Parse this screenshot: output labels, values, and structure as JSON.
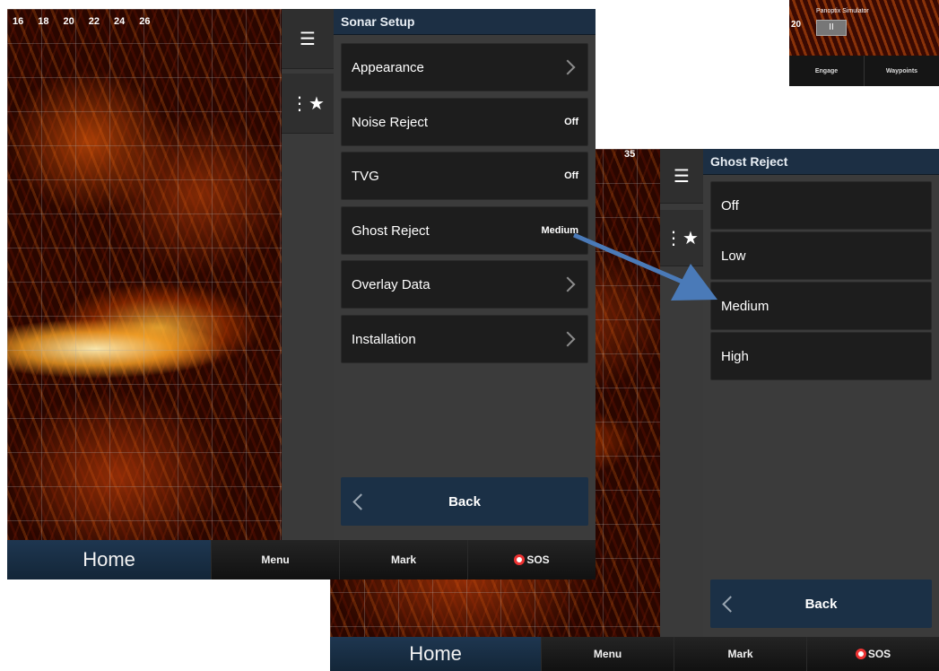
{
  "left_screen": {
    "depth_scale": [
      "16",
      "18",
      "20",
      "22",
      "24",
      "26"
    ],
    "rail": {
      "menu_icon": "hamburger-icon",
      "favorites_icon": "star-list-icon"
    },
    "panel": {
      "title": "Sonar Setup",
      "items": [
        {
          "label": "Appearance",
          "value": "",
          "has_chevron": true
        },
        {
          "label": "Noise Reject",
          "value": "Off",
          "has_chevron": false
        },
        {
          "label": "TVG",
          "value": "Off",
          "has_chevron": false
        },
        {
          "label": "Ghost Reject",
          "value": "Medium",
          "has_chevron": false
        },
        {
          "label": "Overlay Data",
          "value": "",
          "has_chevron": true
        },
        {
          "label": "Installation",
          "value": "",
          "has_chevron": true
        }
      ],
      "back_label": "Back"
    },
    "bottom_bar": {
      "home": "Home",
      "menu": "Menu",
      "mark": "Mark",
      "sos": "SOS"
    }
  },
  "right_screen": {
    "depth_label": "35",
    "panel": {
      "title": "Ghost Reject",
      "options": [
        "Off",
        "Low",
        "Medium",
        "High"
      ],
      "back_label": "Back"
    },
    "bottom_bar": {
      "home": "Home",
      "menu": "Menu",
      "mark": "Mark",
      "sos": "SOS"
    }
  },
  "inset": {
    "depth": "20",
    "title": "Panoptix Simulator",
    "tabs": [
      "Engage",
      "Waypoints"
    ]
  },
  "colors": {
    "title_bar": "#1c2f44",
    "back_button": "#1b3046",
    "arrow": "#4a7ab8",
    "sos_ring": "#e33333"
  }
}
